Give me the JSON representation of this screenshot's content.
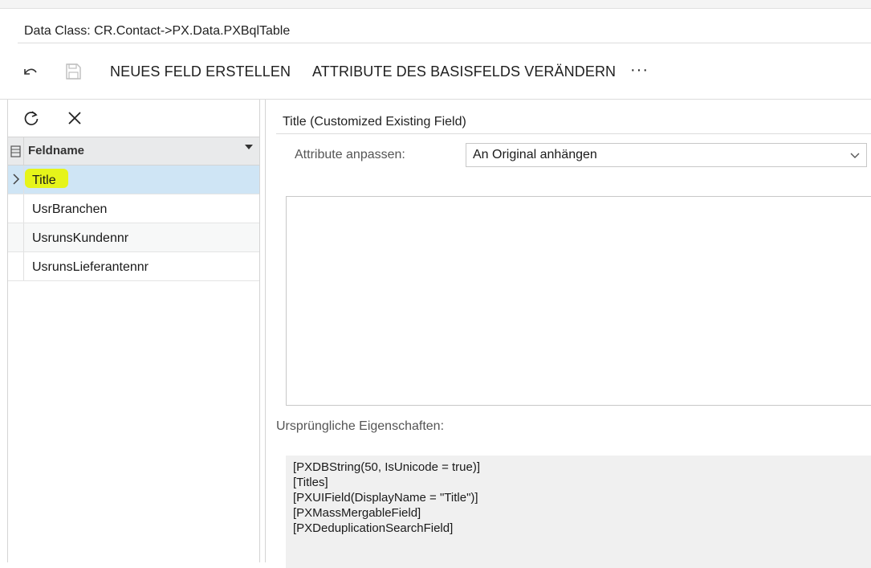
{
  "header": {
    "data_class": "Data Class: CR.Contact->PX.Data.PXBqlTable"
  },
  "toolbar": {
    "undo_icon": "undo-icon",
    "save_icon": "save-icon",
    "new_field_label": "NEUES FELD ERSTELLEN",
    "change_attributes_label": "ATTRIBUTE DES BASISFELDS VERÄNDERN",
    "more_label": "···"
  },
  "grid": {
    "refresh_icon": "refresh-icon",
    "close_icon": "close-icon",
    "column_header": "Feldname",
    "rows": [
      {
        "label": "Title",
        "selected": true
      },
      {
        "label": "UsrBranchen",
        "selected": false
      },
      {
        "label": "UsrunsKundennr",
        "selected": false
      },
      {
        "label": "UsrunsLieferantennr",
        "selected": false
      }
    ]
  },
  "detail": {
    "section_title": "Title (Customized Existing Field)",
    "attribute_label": "Attribute anpassen:",
    "attribute_value": "An Original anhängen",
    "editor_text": "",
    "original_label": "Ursprüngliche Eigenschaften:",
    "original_lines": [
      "[PXDBString(50, IsUnicode = true)]",
      "[Titles]",
      "[PXUIField(DisplayName = \"Title\")]",
      "[PXMassMergableField]",
      "[PXDeduplicationSearchField]"
    ]
  },
  "colors": {
    "selected_row": "#cfe5f5",
    "highlight": "#e6f41a",
    "header_bg": "#e9eaeb"
  }
}
